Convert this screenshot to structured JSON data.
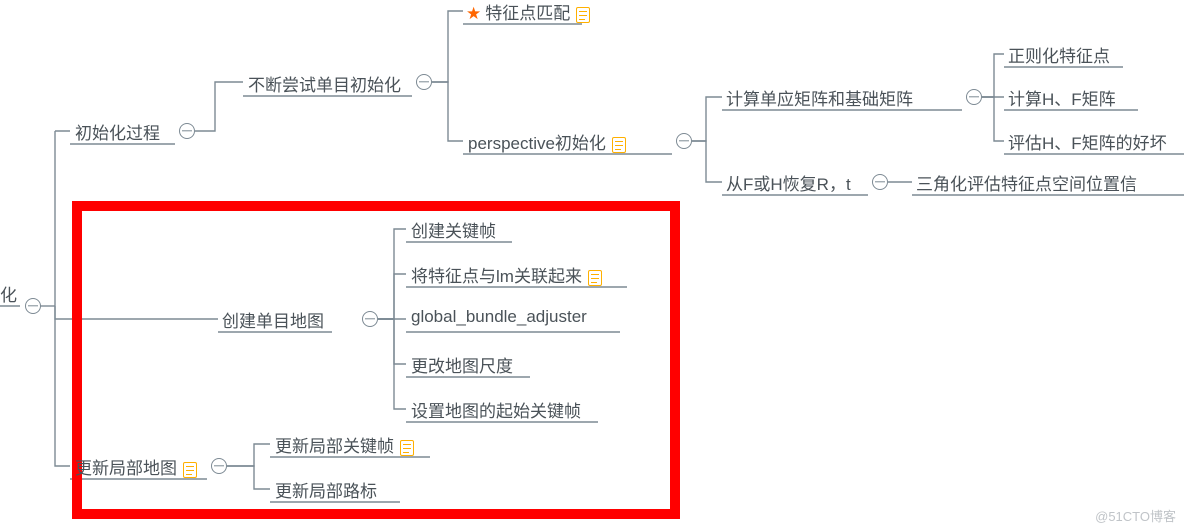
{
  "root": "化",
  "n": {
    "init_process": "初始化过程",
    "try_mono_init": "不断尝试单目初始化",
    "feature_match": "特征点匹配",
    "perspective_init": "perspective初始化",
    "compute_HF": "计算单应矩阵和基础矩阵",
    "regularize_feat": "正则化特征点",
    "compute_HF2": "计算H、F矩阵",
    "evaluate_HF": "评估H、F矩阵的好坏",
    "recover_Rt": "从F或H恢复R，t",
    "triangulate": "三角化评估特征点空间位置信",
    "create_mono_map": "创建单目地图",
    "create_keyframe": "创建关键帧",
    "link_feat_lm": "将特征点与lm关联起来",
    "global_ba": "global_bundle_adjuster",
    "change_scale": "更改地图尺度",
    "set_init_kf": "设置地图的起始关键帧",
    "update_local_map": "更新局部地图",
    "update_local_kf": "更新局部关键帧",
    "update_local_lm": "更新局部路标"
  },
  "watermark": "@51CTO博客"
}
